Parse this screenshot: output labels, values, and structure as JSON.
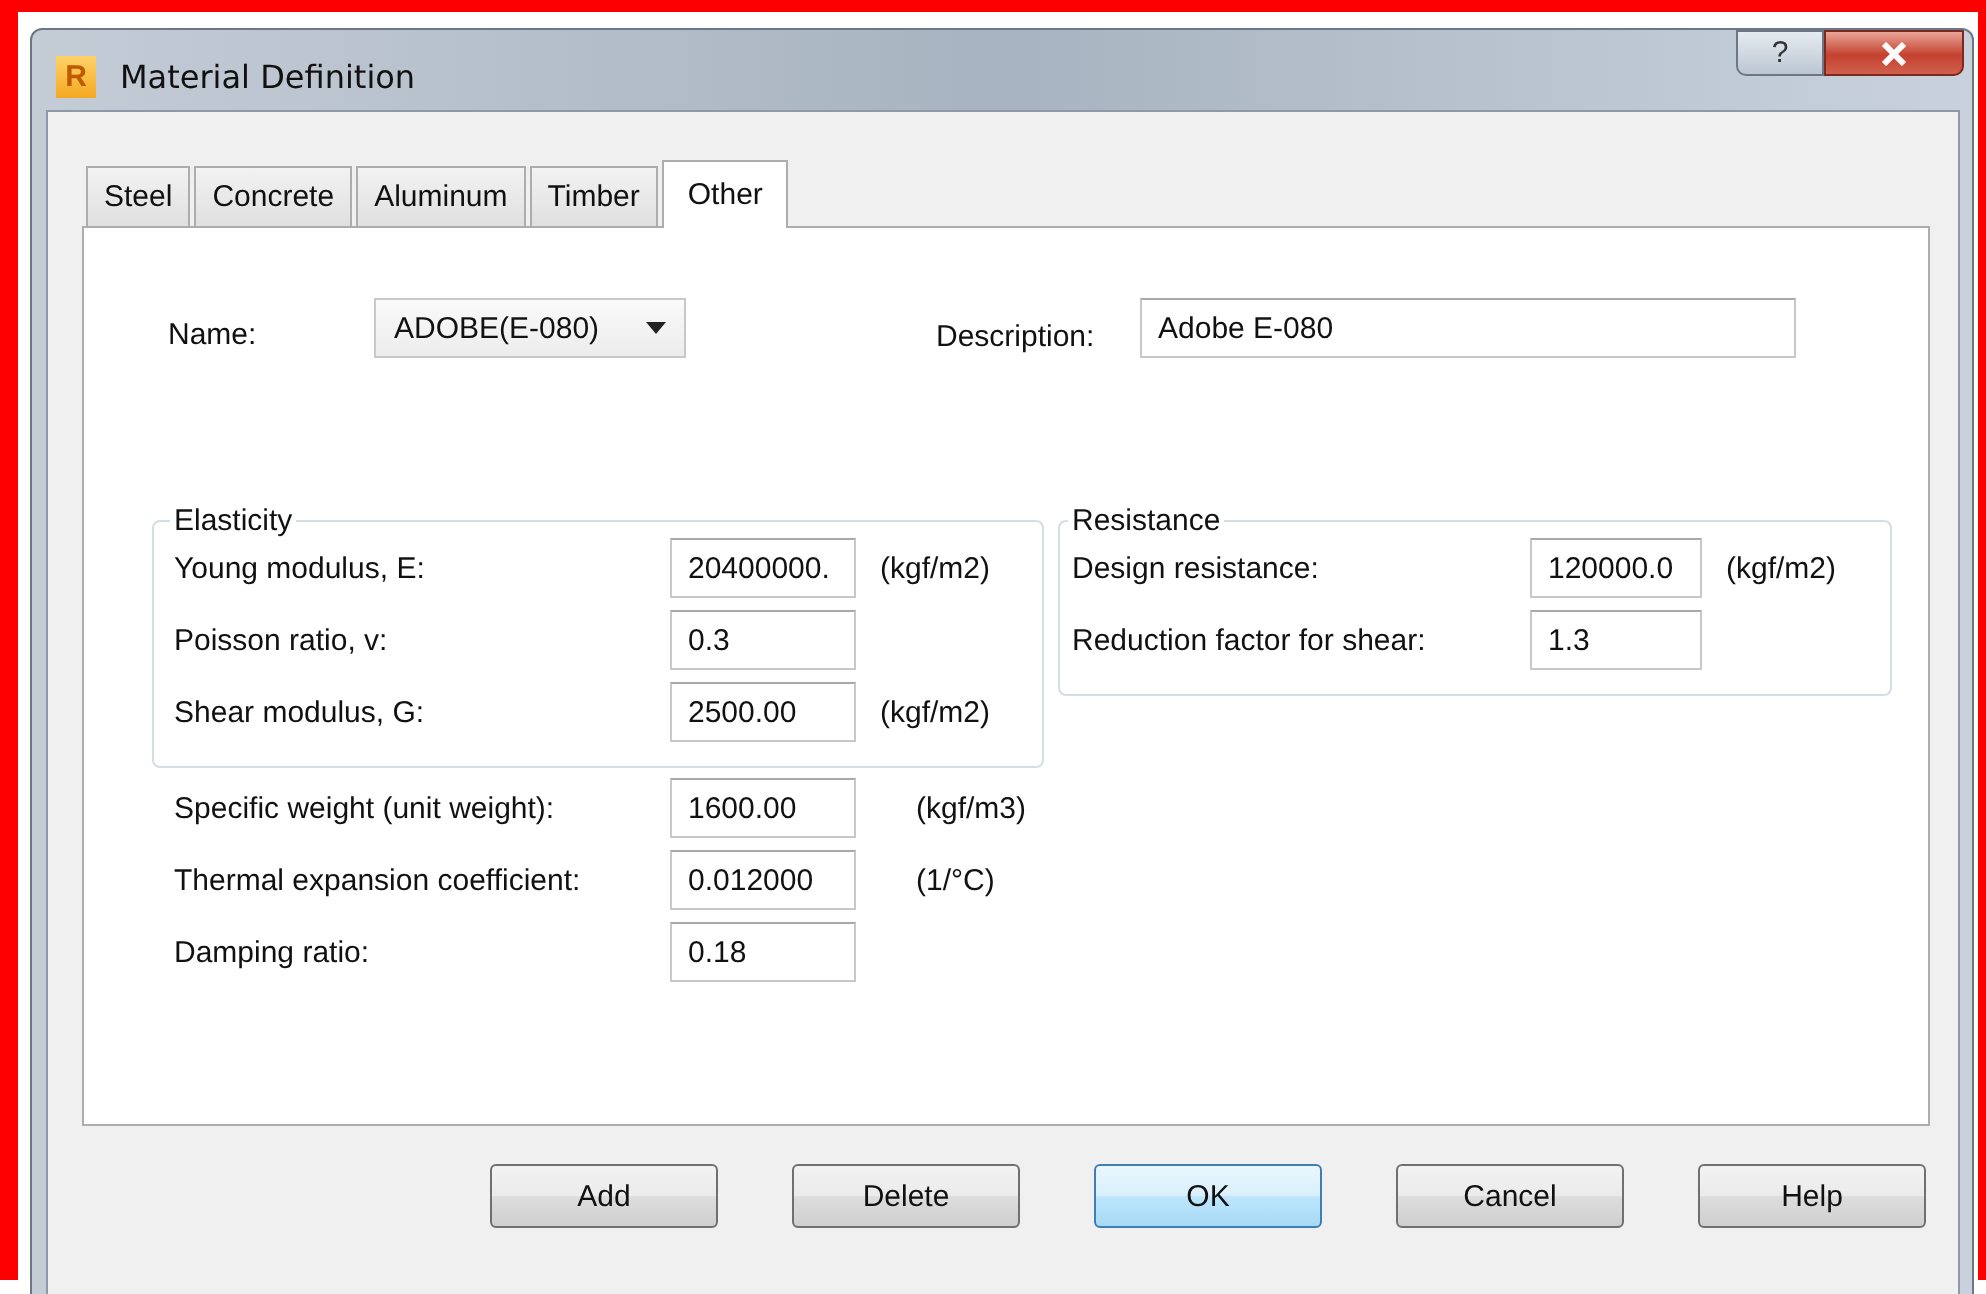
{
  "window": {
    "icon_text": "R",
    "title": "Material Definition",
    "help_button": "?"
  },
  "tabs": [
    {
      "label": "Steel",
      "selected": false
    },
    {
      "label": "Concrete",
      "selected": false
    },
    {
      "label": "Aluminum",
      "selected": false
    },
    {
      "label": "Timber",
      "selected": false
    },
    {
      "label": "Other",
      "selected": true
    }
  ],
  "name": {
    "label": "Name:",
    "value": "ADOBE(E-080)"
  },
  "description": {
    "label": "Description:",
    "value": "Adobe E-080"
  },
  "elasticity": {
    "title": "Elasticity",
    "rows": [
      {
        "label": "Young modulus, E:",
        "value": "20400000.",
        "unit": "(kgf/m2)"
      },
      {
        "label": "Poisson ratio, v:",
        "value": "0.3"
      },
      {
        "label": "Shear modulus, G:",
        "value": "2500.00",
        "unit": "(kgf/m2)"
      }
    ]
  },
  "resistance": {
    "title": "Resistance",
    "rows": [
      {
        "label": "Design resistance:",
        "value": "120000.0",
        "unit": "(kgf/m2)"
      },
      {
        "label": "Reduction factor for shear:",
        "value": "1.3"
      }
    ]
  },
  "properties": [
    {
      "label": "Specific weight (unit weight):",
      "value": "1600.00",
      "unit": "(kgf/m3)"
    },
    {
      "label": "Thermal expansion coefficient:",
      "value": "0.012000",
      "unit": "(1/°C)"
    },
    {
      "label": "Damping ratio:",
      "value": "0.18"
    }
  ],
  "buttons": [
    {
      "label": "Add",
      "default": false
    },
    {
      "label": "Delete",
      "default": false
    },
    {
      "label": "OK",
      "default": true
    },
    {
      "label": "Cancel",
      "default": false
    },
    {
      "label": "Help",
      "default": false
    }
  ]
}
